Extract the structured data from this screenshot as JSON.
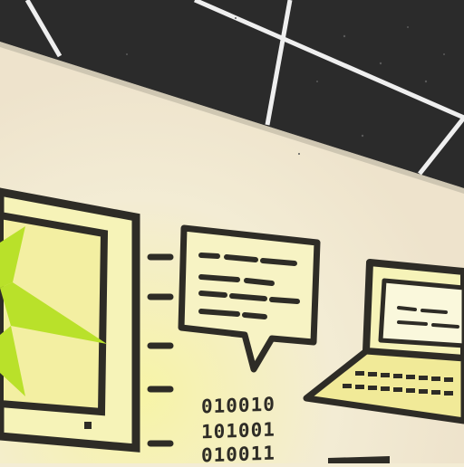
{
  "scene": {
    "ceiling": {
      "color": "#2b2b2b",
      "grid_color": "#efefef"
    },
    "wall": {
      "color": "#f3ecd4",
      "glow_color": "#f7f4a6"
    },
    "mural": {
      "ink_color": "#2e2c26",
      "accent_color": "#b9e12a",
      "binary_text": [
        "010010",
        "101001",
        "010011"
      ]
    }
  }
}
